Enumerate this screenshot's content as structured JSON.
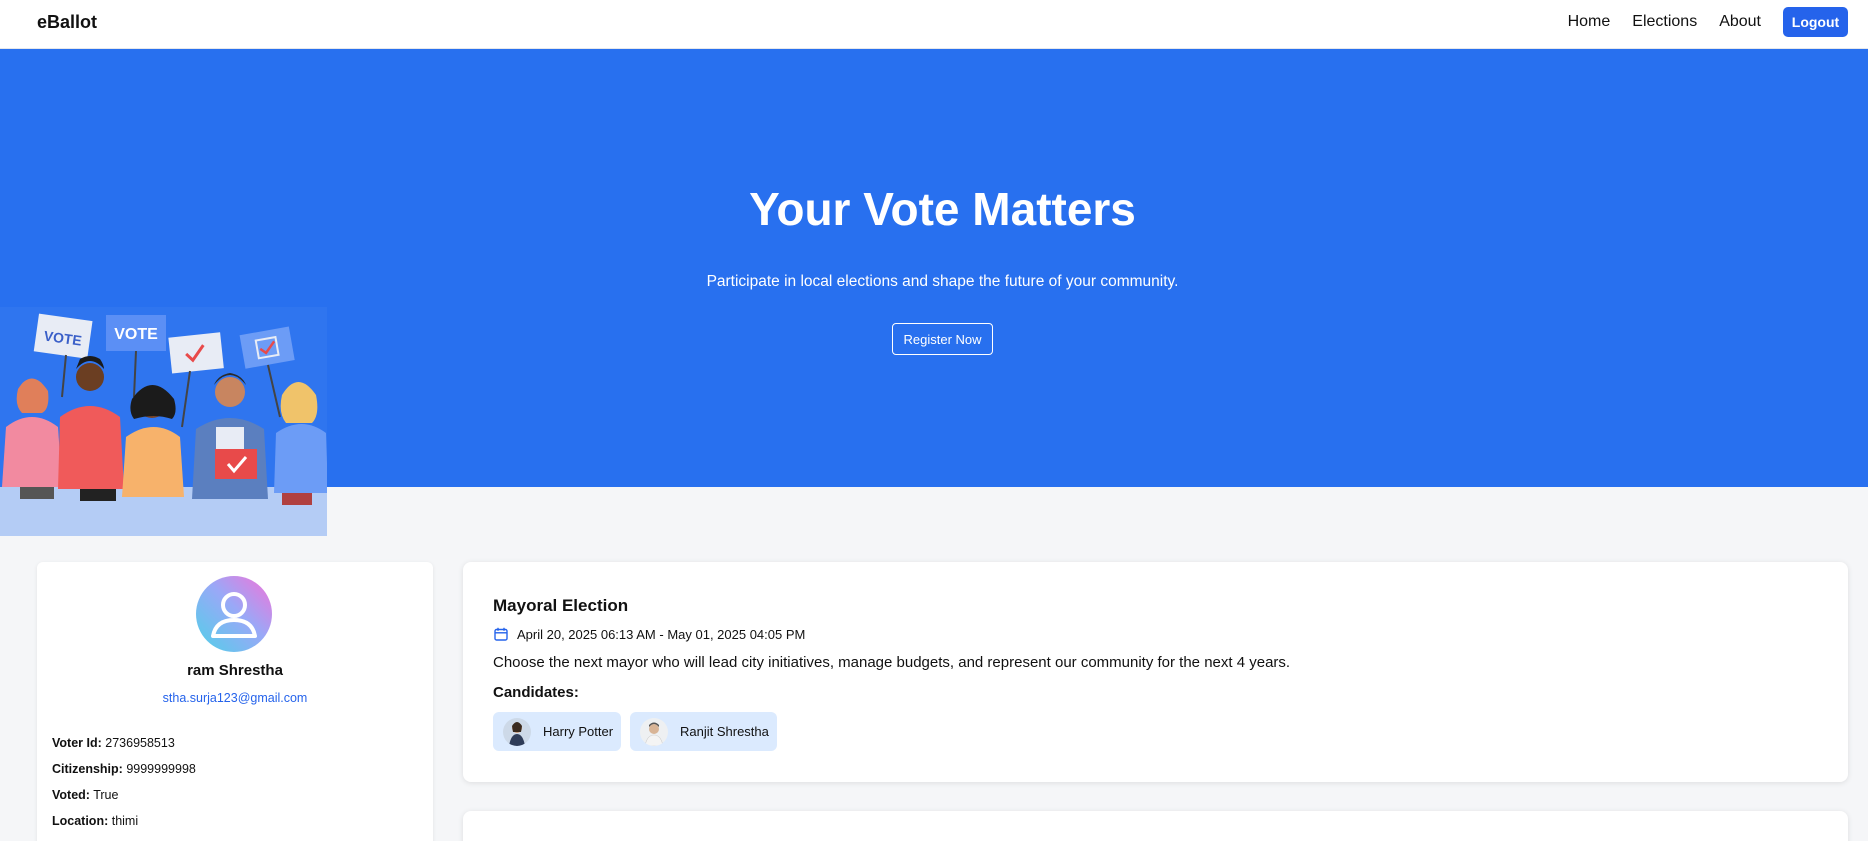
{
  "navbar": {
    "brand": "eBallot",
    "links": [
      "Home",
      "Elections",
      "About"
    ],
    "logout_label": "Logout"
  },
  "hero": {
    "title": "Your Vote Matters",
    "subtitle": "Participate in local elections and shape the future of your community.",
    "register_label": "Register Now",
    "illustration_sign_text": [
      "VOTE",
      "VOTE"
    ]
  },
  "profile": {
    "name": "ram Shrestha",
    "email": "stha.surja123@gmail.com",
    "fields": [
      {
        "label": "Voter Id:",
        "value": "2736958513"
      },
      {
        "label": "Citizenship:",
        "value": "9999999998"
      },
      {
        "label": "Voted:",
        "value": "True"
      },
      {
        "label": "Location:",
        "value": "thimi"
      }
    ]
  },
  "elections": [
    {
      "title": "Mayoral Election",
      "dates": "April 20, 2025 06:13 AM - May 01, 2025 04:05 PM",
      "description": "Choose the next mayor who will lead city initiatives, manage budgets, and represent our community for the next 4 years.",
      "candidates_label": "Candidates:",
      "candidates": [
        "Harry Potter",
        "Ranjit Shrestha"
      ]
    }
  ],
  "colors": {
    "primary": "#2563eb",
    "hero_bg": "#2870ef",
    "page_bg": "#f5f6f8",
    "chip_bg": "#dbeafe"
  },
  "icons": [
    "calendar-icon",
    "user-avatar-icon"
  ]
}
